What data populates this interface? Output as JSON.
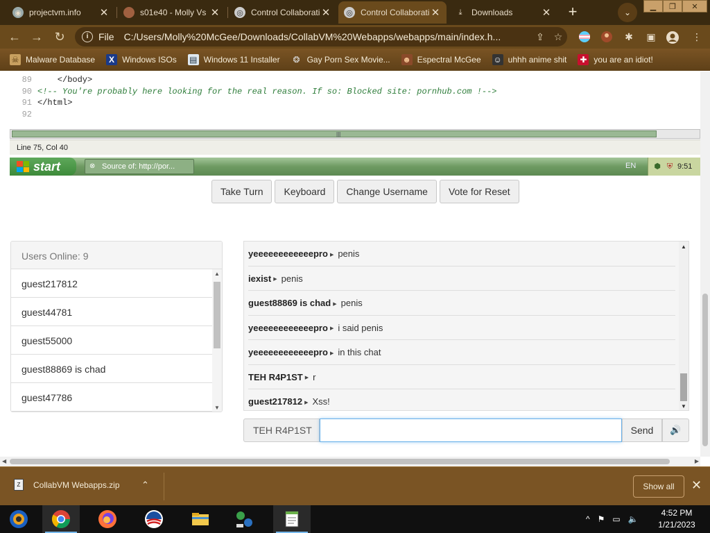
{
  "browser": {
    "tabs": [
      {
        "title": "projectvm.info",
        "icon": "globe-icon"
      },
      {
        "title": "s01e40 - Molly Vs",
        "icon": "avatar-icon"
      },
      {
        "title": "Control Collaborati",
        "icon": "globe-icon"
      },
      {
        "title": "Control Collaborati",
        "icon": "globe-icon"
      },
      {
        "title": "Downloads",
        "icon": "download-icon"
      }
    ],
    "new_tab_label": "+",
    "scheme_label": "File",
    "url": "C:/Users/Molly%20McGee/Downloads/CollabVM%20Webapps/webapps/main/index.h...",
    "bookmarks": [
      {
        "label": "Malware Database",
        "icon": "malware-icon"
      },
      {
        "label": "Windows ISOs",
        "icon": "x-logo-icon"
      },
      {
        "label": "Windows 11 Installer",
        "icon": "installer-icon"
      },
      {
        "label": "Gay Porn Sex Movie...",
        "icon": "globe-icon"
      },
      {
        "label": "Espectral McGee",
        "icon": "avatar-icon"
      },
      {
        "label": "uhhh anime shit",
        "icon": "anime-icon"
      },
      {
        "label": "you are an idiot!",
        "icon": "flag-icon"
      }
    ]
  },
  "vm": {
    "code_lines": [
      {
        "num": "89",
        "text": "    </body>",
        "comment": false
      },
      {
        "num": "90",
        "text": "<!-- You're probably here looking for the real reason. If so: Blocked site: pornhub.com !-->",
        "comment": true
      },
      {
        "num": "91",
        "text": "</html>",
        "comment": false
      },
      {
        "num": "92",
        "text": "",
        "comment": false
      }
    ],
    "status": "Line 75, Col 40",
    "start_label": "start",
    "task_label": "Source of: http://por...",
    "lang": "EN",
    "clock": "9:51"
  },
  "controls": {
    "buttons": [
      "Take Turn",
      "Keyboard",
      "Change Username",
      "Vote for Reset"
    ]
  },
  "users": {
    "header": "Users Online: 9",
    "list": [
      "guest217812",
      "guest44781",
      "guest55000",
      "guest88869 is chad",
      "guest47786"
    ]
  },
  "chat": {
    "messages": [
      {
        "user": "yeeeeeeeeeeeepro",
        "text": "penis"
      },
      {
        "user": "iexist",
        "text": "penis"
      },
      {
        "user": "guest88869 is chad",
        "text": "penis"
      },
      {
        "user": "yeeeeeeeeeeeepro",
        "text": "i said penis"
      },
      {
        "user": "yeeeeeeeeeeeepro",
        "text": "in this chat"
      },
      {
        "user": "TEH R4P1ST",
        "text": "r"
      },
      {
        "user": "guest217812",
        "text": "Xss!"
      }
    ],
    "username": "TEH R4P1ST",
    "input_value": "",
    "send_label": "Send"
  },
  "downloads": {
    "file_name": "CollabVM Webapps.zip",
    "show_all_label": "Show all"
  },
  "taskbar": {
    "time": "4:52 PM",
    "date": "1/21/2023",
    "apps": [
      "windows-media-icon",
      "chrome-icon",
      "firefox-icon",
      "obama-logo-icon",
      "file-explorer-icon",
      "network-icon",
      "notepad-icon"
    ]
  }
}
